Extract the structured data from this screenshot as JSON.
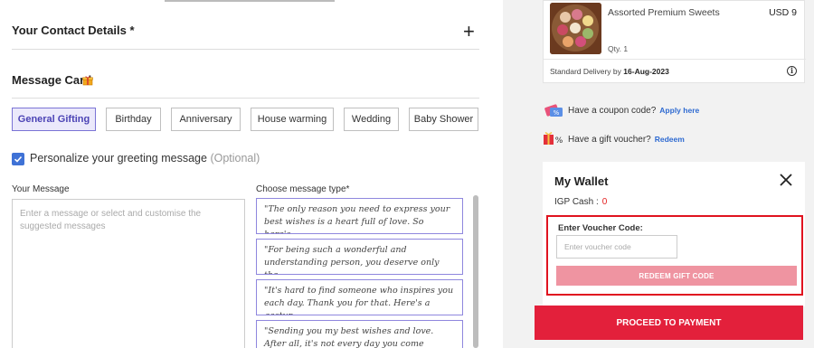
{
  "contact": {
    "title": "Your Contact Details *"
  },
  "message_card": {
    "title": "Message Card",
    "occasions": [
      "General Gifting",
      "Birthday",
      "Anniversary",
      "House warming",
      "Wedding",
      "Baby Shower"
    ],
    "personalize_label": "Personalize your greeting message",
    "personalize_optional": "(Optional)",
    "your_message_label": "Your Message",
    "message_placeholder": "Enter a message or select and customise the suggested messages",
    "choose_type_label": "Choose message type*",
    "suggestions": [
      "\"The only reason you need to express your best wishes is a heart full of love. So here's...",
      "\"For being such a wonderful and understanding person, you deserve only the...",
      "\"It's hard to find someone who inspires you each day. Thank you for that. Here's a gestur...",
      "\"Sending you my best wishes and love. After all, it's not every day you come across..."
    ]
  },
  "order": {
    "product_name": "Assorted Premium Sweets",
    "price": "USD 9",
    "qty": "Qty. 1",
    "delivery_prefix": "Standard Delivery by",
    "delivery_date": "16-Aug-2023"
  },
  "coupon": {
    "text": "Have a coupon code?",
    "link": "Apply here"
  },
  "voucher": {
    "text": "Have a gift voucher?",
    "link": "Redeem"
  },
  "wallet": {
    "title": "My Wallet",
    "igp_cash_label": "IGP Cash :",
    "igp_cash_value": "0",
    "voucher_label": "Enter Voucher Code:",
    "voucher_placeholder": "Enter voucher code",
    "redeem_button": "REDEEM GIFT CODE"
  },
  "proceed_button": "PROCEED TO PAYMENT",
  "colors": {
    "accent": "#e3203b",
    "chip_active": "#7b74d6",
    "link": "#2e6ad1",
    "checkbox": "#3f72d6"
  }
}
